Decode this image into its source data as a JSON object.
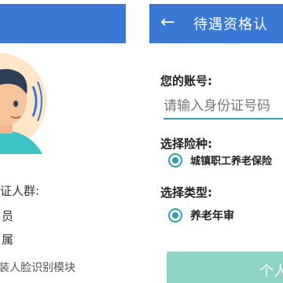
{
  "left_panel": {
    "cert_title": "证人群:",
    "cert_options": [
      "员",
      "属"
    ],
    "install_hint": "装人脸识别模块",
    "avatar_icon": "face-recognition-avatar-icon"
  },
  "right_panel": {
    "app_bar": {
      "back_icon": "←",
      "title": "待遇资格认"
    },
    "account": {
      "label": "您的账号:",
      "placeholder": "请输入身份证号码"
    },
    "insurance": {
      "label": "选择险种:",
      "selected": "城镇职工养老保险"
    },
    "type": {
      "label": "选择类型:",
      "selected": "养老年审"
    },
    "submit_label": "个人"
  },
  "colors": {
    "header_blue": "#3a78d6",
    "radio_teal": "#2e9fb3",
    "button_mint": "#8fd3c6"
  }
}
